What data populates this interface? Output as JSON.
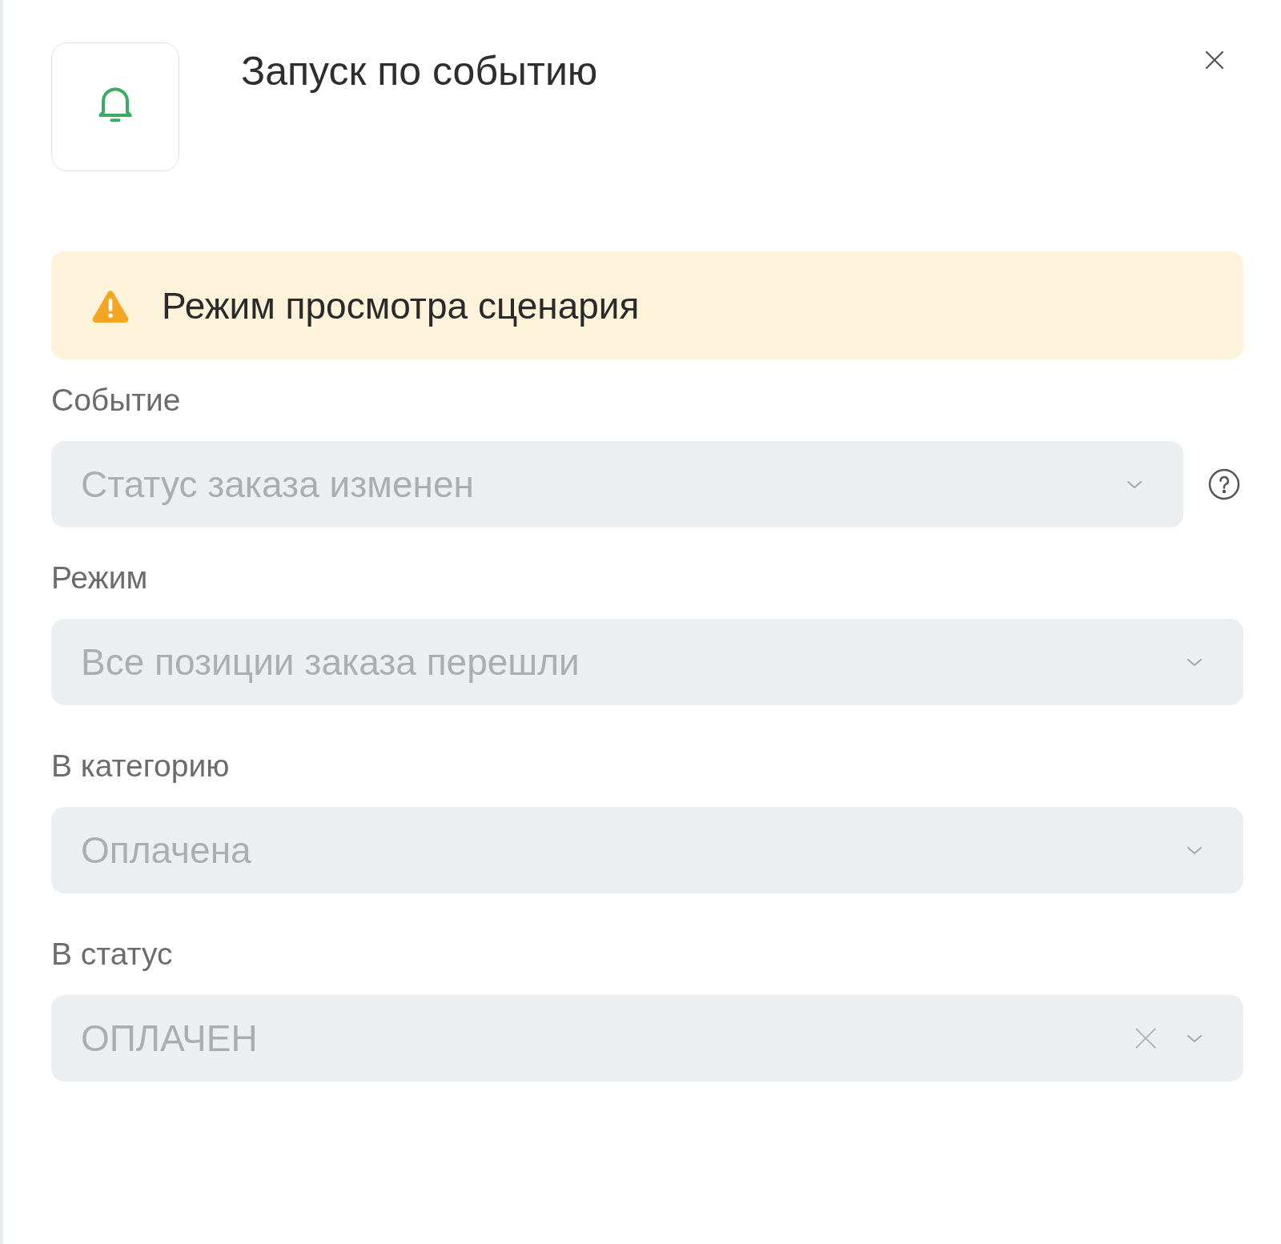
{
  "dialog": {
    "title": "Запуск по событию"
  },
  "alert": {
    "kind": "warning",
    "text": "Режим просмотра сценария"
  },
  "fields": [
    {
      "label": "Событие",
      "value": "Статус заказа изменен",
      "disabled": true,
      "help": true,
      "clearable": false
    },
    {
      "label": "Режим",
      "value": "Все позиции заказа перешли",
      "disabled": true,
      "help": false,
      "clearable": false
    },
    {
      "label": "В категорию",
      "value": "Оплачена",
      "disabled": true,
      "help": false,
      "clearable": false
    },
    {
      "label": "В статус",
      "value": "ОПЛАЧЕН",
      "disabled": true,
      "help": false,
      "clearable": true
    }
  ]
}
